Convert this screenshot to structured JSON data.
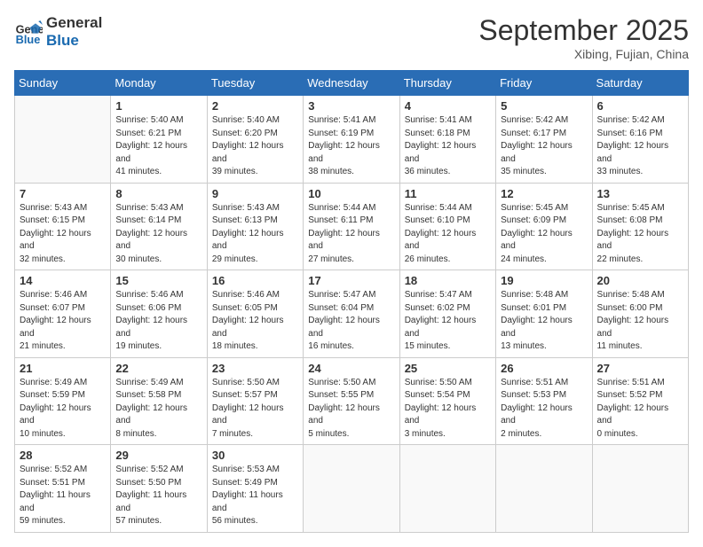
{
  "logo": {
    "line1": "General",
    "line2": "Blue"
  },
  "title": "September 2025",
  "location": "Xibing, Fujian, China",
  "days_of_week": [
    "Sunday",
    "Monday",
    "Tuesday",
    "Wednesday",
    "Thursday",
    "Friday",
    "Saturday"
  ],
  "weeks": [
    [
      {
        "day": null
      },
      {
        "day": 1,
        "sunrise": "5:40 AM",
        "sunset": "6:21 PM",
        "daylight": "12 hours and 41 minutes."
      },
      {
        "day": 2,
        "sunrise": "5:40 AM",
        "sunset": "6:20 PM",
        "daylight": "12 hours and 39 minutes."
      },
      {
        "day": 3,
        "sunrise": "5:41 AM",
        "sunset": "6:19 PM",
        "daylight": "12 hours and 38 minutes."
      },
      {
        "day": 4,
        "sunrise": "5:41 AM",
        "sunset": "6:18 PM",
        "daylight": "12 hours and 36 minutes."
      },
      {
        "day": 5,
        "sunrise": "5:42 AM",
        "sunset": "6:17 PM",
        "daylight": "12 hours and 35 minutes."
      },
      {
        "day": 6,
        "sunrise": "5:42 AM",
        "sunset": "6:16 PM",
        "daylight": "12 hours and 33 minutes."
      }
    ],
    [
      {
        "day": 7,
        "sunrise": "5:43 AM",
        "sunset": "6:15 PM",
        "daylight": "12 hours and 32 minutes."
      },
      {
        "day": 8,
        "sunrise": "5:43 AM",
        "sunset": "6:14 PM",
        "daylight": "12 hours and 30 minutes."
      },
      {
        "day": 9,
        "sunrise": "5:43 AM",
        "sunset": "6:13 PM",
        "daylight": "12 hours and 29 minutes."
      },
      {
        "day": 10,
        "sunrise": "5:44 AM",
        "sunset": "6:11 PM",
        "daylight": "12 hours and 27 minutes."
      },
      {
        "day": 11,
        "sunrise": "5:44 AM",
        "sunset": "6:10 PM",
        "daylight": "12 hours and 26 minutes."
      },
      {
        "day": 12,
        "sunrise": "5:45 AM",
        "sunset": "6:09 PM",
        "daylight": "12 hours and 24 minutes."
      },
      {
        "day": 13,
        "sunrise": "5:45 AM",
        "sunset": "6:08 PM",
        "daylight": "12 hours and 22 minutes."
      }
    ],
    [
      {
        "day": 14,
        "sunrise": "5:46 AM",
        "sunset": "6:07 PM",
        "daylight": "12 hours and 21 minutes."
      },
      {
        "day": 15,
        "sunrise": "5:46 AM",
        "sunset": "6:06 PM",
        "daylight": "12 hours and 19 minutes."
      },
      {
        "day": 16,
        "sunrise": "5:46 AM",
        "sunset": "6:05 PM",
        "daylight": "12 hours and 18 minutes."
      },
      {
        "day": 17,
        "sunrise": "5:47 AM",
        "sunset": "6:04 PM",
        "daylight": "12 hours and 16 minutes."
      },
      {
        "day": 18,
        "sunrise": "5:47 AM",
        "sunset": "6:02 PM",
        "daylight": "12 hours and 15 minutes."
      },
      {
        "day": 19,
        "sunrise": "5:48 AM",
        "sunset": "6:01 PM",
        "daylight": "12 hours and 13 minutes."
      },
      {
        "day": 20,
        "sunrise": "5:48 AM",
        "sunset": "6:00 PM",
        "daylight": "12 hours and 11 minutes."
      }
    ],
    [
      {
        "day": 21,
        "sunrise": "5:49 AM",
        "sunset": "5:59 PM",
        "daylight": "12 hours and 10 minutes."
      },
      {
        "day": 22,
        "sunrise": "5:49 AM",
        "sunset": "5:58 PM",
        "daylight": "12 hours and 8 minutes."
      },
      {
        "day": 23,
        "sunrise": "5:50 AM",
        "sunset": "5:57 PM",
        "daylight": "12 hours and 7 minutes."
      },
      {
        "day": 24,
        "sunrise": "5:50 AM",
        "sunset": "5:55 PM",
        "daylight": "12 hours and 5 minutes."
      },
      {
        "day": 25,
        "sunrise": "5:50 AM",
        "sunset": "5:54 PM",
        "daylight": "12 hours and 3 minutes."
      },
      {
        "day": 26,
        "sunrise": "5:51 AM",
        "sunset": "5:53 PM",
        "daylight": "12 hours and 2 minutes."
      },
      {
        "day": 27,
        "sunrise": "5:51 AM",
        "sunset": "5:52 PM",
        "daylight": "12 hours and 0 minutes."
      }
    ],
    [
      {
        "day": 28,
        "sunrise": "5:52 AM",
        "sunset": "5:51 PM",
        "daylight": "11 hours and 59 minutes."
      },
      {
        "day": 29,
        "sunrise": "5:52 AM",
        "sunset": "5:50 PM",
        "daylight": "11 hours and 57 minutes."
      },
      {
        "day": 30,
        "sunrise": "5:53 AM",
        "sunset": "5:49 PM",
        "daylight": "11 hours and 56 minutes."
      },
      {
        "day": null
      },
      {
        "day": null
      },
      {
        "day": null
      },
      {
        "day": null
      }
    ]
  ]
}
